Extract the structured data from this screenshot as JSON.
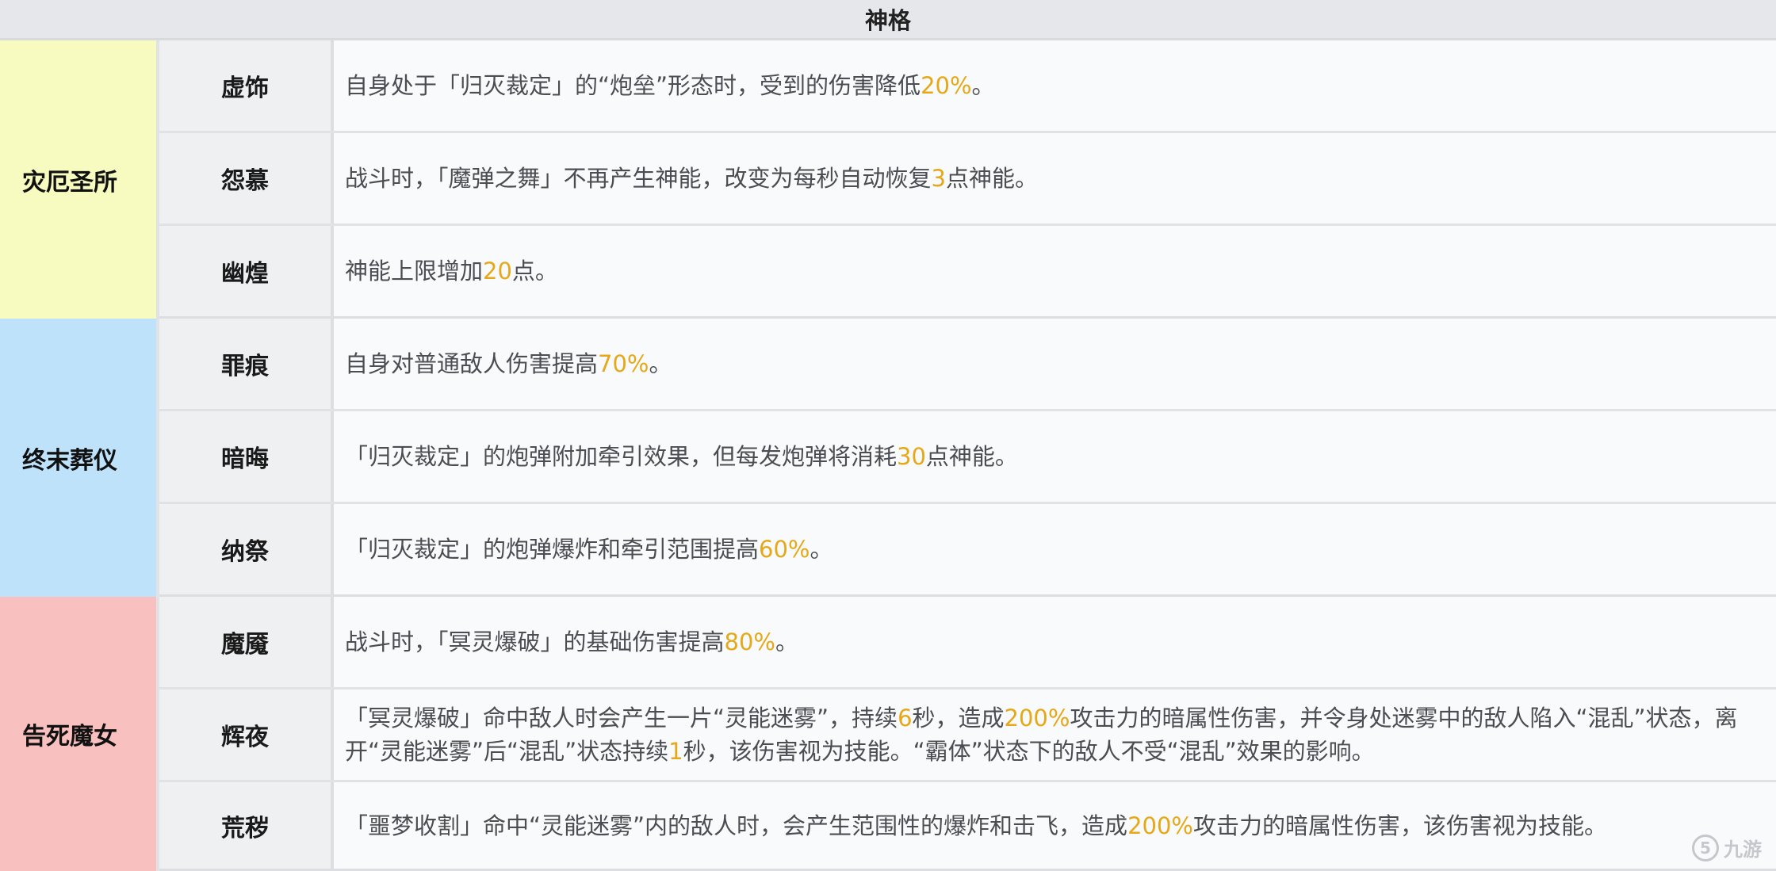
{
  "title": "神格",
  "colors": {
    "highlight": "#e6a817",
    "group_1": "#f7fbbf",
    "group_2": "#bfe2fb",
    "group_3": "#f9c0c0"
  },
  "groups": [
    {
      "label": "灾厄圣所",
      "rows": [
        {
          "name": "虚饰",
          "desc": [
            {
              "t": "自身处于「归灭裁定」的“炮垒”形态时，受到的伤害降低"
            },
            {
              "t": "20%",
              "hl": true
            },
            {
              "t": "。"
            }
          ]
        },
        {
          "name": "怨慕",
          "desc": [
            {
              "t": "战斗时，「魔弹之舞」不再产生神能，改变为每秒自动恢复"
            },
            {
              "t": "3",
              "hl": true
            },
            {
              "t": "点神能。"
            }
          ]
        },
        {
          "name": "幽煌",
          "desc": [
            {
              "t": "神能上限增加"
            },
            {
              "t": "20",
              "hl": true
            },
            {
              "t": "点。"
            }
          ]
        }
      ]
    },
    {
      "label": "终末葬仪",
      "rows": [
        {
          "name": "罪痕",
          "desc": [
            {
              "t": "自身对普通敌人伤害提高"
            },
            {
              "t": "70%",
              "hl": true
            },
            {
              "t": "。"
            }
          ]
        },
        {
          "name": "暗晦",
          "desc": [
            {
              "t": "「归灭裁定」的炮弹附加牵引效果，但每发炮弹将消耗"
            },
            {
              "t": "30",
              "hl": true
            },
            {
              "t": "点神能。"
            }
          ]
        },
        {
          "name": "纳祭",
          "desc": [
            {
              "t": "「归灭裁定」的炮弹爆炸和牵引范围提高"
            },
            {
              "t": "60%",
              "hl": true
            },
            {
              "t": "。"
            }
          ]
        }
      ]
    },
    {
      "label": "告死魔女",
      "rows": [
        {
          "name": "魔魇",
          "desc": [
            {
              "t": "战斗时，「冥灵爆破」的基础伤害提高"
            },
            {
              "t": "80%",
              "hl": true
            },
            {
              "t": "。"
            }
          ]
        },
        {
          "name": "辉夜",
          "desc": [
            {
              "t": "「冥灵爆破」命中敌人时会产生一片“灵能迷雾”，持续"
            },
            {
              "t": "6",
              "hl": true
            },
            {
              "t": "秒，造成"
            },
            {
              "t": "200%",
              "hl": true
            },
            {
              "t": "攻击力的暗属性伤害，并令身处迷雾中的敌人陷入“混乱”状态，离开“灵能迷雾”后“混乱”状态持续"
            },
            {
              "t": "1",
              "hl": true
            },
            {
              "t": "秒，该伤害视为技能。“霸体”状态下的敌人不受“混乱”效果的影响。"
            }
          ]
        },
        {
          "name": "荒秽",
          "desc": [
            {
              "t": "「噩梦收割」命中“灵能迷雾”内的敌人时，会产生范围性的爆炸和击飞，造成"
            },
            {
              "t": "200%",
              "hl": true
            },
            {
              "t": "攻击力的暗属性伤害，该伤害视为技能。"
            }
          ]
        }
      ]
    }
  ],
  "watermark": {
    "icon": "jiuyou-logo-icon",
    "text": "九游"
  }
}
